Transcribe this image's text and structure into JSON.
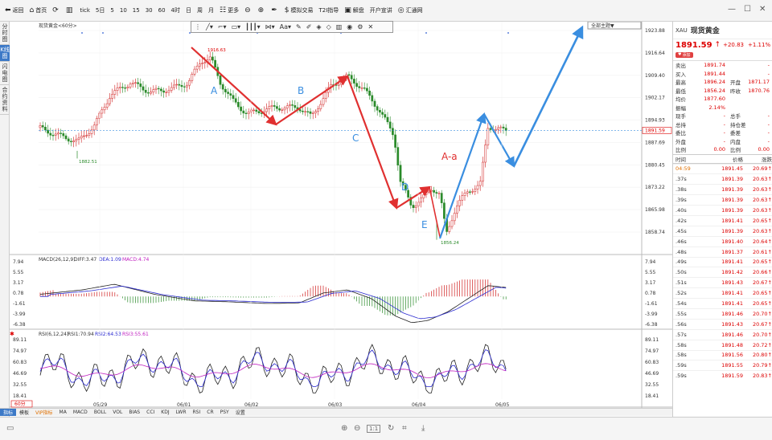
{
  "toolbar": {
    "items": [
      {
        "label": "返回",
        "icon": "arrow-left-icon"
      },
      {
        "label": "首页",
        "icon": "home-icon"
      },
      {
        "label": "",
        "icon": "refresh-icon"
      },
      {
        "label": "",
        "icon": "bar-chart-icon"
      },
      {
        "label": "tick"
      },
      {
        "label": "5日"
      },
      {
        "label": "5"
      },
      {
        "label": "10"
      },
      {
        "label": "15"
      },
      {
        "label": "30"
      },
      {
        "label": "60"
      },
      {
        "label": "4时"
      },
      {
        "label": "日"
      },
      {
        "label": "周"
      },
      {
        "label": "月"
      },
      {
        "label": "更多",
        "icon": "grid-icon"
      },
      {
        "label": "",
        "icon": "zoom-out-icon"
      },
      {
        "label": "",
        "icon": "zoom-in-icon"
      },
      {
        "label": "",
        "icon": "pen-icon"
      },
      {
        "label": "模拟交易",
        "icon": "dollar-icon"
      },
      {
        "label": "T2I指导"
      },
      {
        "label": "解盘",
        "icon": "monitor-icon"
      },
      {
        "label": "开户宣讲"
      },
      {
        "label": "汇通网",
        "icon": "globe-icon"
      }
    ]
  },
  "left_tabs": [
    "分时图",
    "K线图",
    "闪电图",
    "合约资料"
  ],
  "chart": {
    "title": "现货黄金<60分>",
    "theme_button": "全部主题▼",
    "price_labels": [
      "1923.88",
      "1916.64",
      "1909.40",
      "1902.17",
      "1894.93",
      "1887.69",
      "1880.45",
      "1873.22",
      "1865.98",
      "1858.74"
    ],
    "current_price": "1891.59",
    "high_label": "1916.63",
    "low_label1": "1882.51",
    "low_label2": "1856.24",
    "macd_legend": {
      "name": "MACD(26,12,9)",
      "diff": "DIFF:3.47",
      "dea": "DEA:1.09",
      "macd": "MACD:4.74"
    },
    "macd_labels": [
      "7.94",
      "5.55",
      "3.17",
      "0.78",
      "-1.61",
      "-3.99",
      "-6.38"
    ],
    "rsi_legend": {
      "name": "RSI(6,12,24)",
      "rsi1": "RSI1:70.94",
      "rsi2": "RSI2:64.53",
      "rsi3": "RSI3:55.61"
    },
    "rsi_labels": [
      "89.11",
      "74.97",
      "60.83",
      "46.69",
      "32.55",
      "18.41"
    ],
    "date_labels": [
      "05/29",
      "06/01",
      "06/02",
      "06/03",
      "06/04",
      "06/05"
    ],
    "annotations": [
      "A",
      "B",
      "C",
      "D",
      "E",
      "A-a"
    ],
    "period_badge": "60分"
  },
  "indicator_tabs": [
    "指标",
    "模板",
    "VIP指标",
    "MA",
    "MACD",
    "BOLL",
    "VOL",
    "BIAS",
    "CCI",
    "KDJ",
    "LWR",
    "RSI",
    "CR",
    "PSY",
    "设置"
  ],
  "quote": {
    "symbol": "XAU",
    "name": "现货黄金",
    "price": "1891.59",
    "arrow": "↑",
    "change": "+20.83",
    "change_pct": "+1.11%",
    "add_button": "添加",
    "rows": [
      {
        "k1": "卖出",
        "v1": "1891.74",
        "k2": "",
        "v2": "-"
      },
      {
        "k1": "买入",
        "v1": "1891.44",
        "k2": "",
        "v2": "-"
      },
      {
        "k1": "最高",
        "v1": "1896.24",
        "k2": "开盘",
        "v2": "1871.17"
      },
      {
        "k1": "最低",
        "v1": "1856.24",
        "k2": "昨收",
        "v2": "1870.76"
      },
      {
        "k1": "均价",
        "v1": "1877.60",
        "k2": "",
        "v2": ""
      },
      {
        "k1": "振幅",
        "v1": "2.14%",
        "k2": "",
        "v2": ""
      },
      {
        "k1": "现手",
        "v1": "-",
        "k2": "总手",
        "v2": "-"
      },
      {
        "k1": "总持",
        "v1": "-",
        "k2": "持仓差",
        "v2": "-"
      },
      {
        "k1": "委比",
        "v1": "-",
        "k2": "委差",
        "v2": "-"
      },
      {
        "k1": "外盘",
        "v1": "-",
        "k2": "内盘",
        "v2": "-"
      },
      {
        "k1": "比例",
        "v1": "0.00",
        "k2": "比例",
        "v2": "0.00"
      }
    ],
    "tick_headers": [
      "时间",
      "价格",
      "涨跌"
    ],
    "ticks": [
      {
        "t": "04:59",
        "p": "1891.45",
        "v": "20.69↑"
      },
      {
        "t": ".37s",
        "p": "1891.39",
        "v": "20.63↑"
      },
      {
        "t": ".38s",
        "p": "1891.39",
        "v": "20.63↑"
      },
      {
        "t": ".39s",
        "p": "1891.39",
        "v": "20.63↑"
      },
      {
        "t": ".40s",
        "p": "1891.39",
        "v": "20.63↑"
      },
      {
        "t": ".42s",
        "p": "1891.41",
        "v": "20.65↑"
      },
      {
        "t": ".45s",
        "p": "1891.39",
        "v": "20.63↑"
      },
      {
        "t": ".46s",
        "p": "1891.40",
        "v": "20.64↑"
      },
      {
        "t": ".48s",
        "p": "1891.37",
        "v": "20.61↑"
      },
      {
        "t": ".49s",
        "p": "1891.41",
        "v": "20.65↑"
      },
      {
        "t": ".50s",
        "p": "1891.42",
        "v": "20.66↑"
      },
      {
        "t": ".51s",
        "p": "1891.43",
        "v": "20.67↑"
      },
      {
        "t": ".52s",
        "p": "1891.41",
        "v": "20.65↑"
      },
      {
        "t": ".54s",
        "p": "1891.41",
        "v": "20.65↑"
      },
      {
        "t": ".55s",
        "p": "1891.46",
        "v": "20.70↑"
      },
      {
        "t": ".56s",
        "p": "1891.43",
        "v": "20.67↑"
      },
      {
        "t": ".57s",
        "p": "1891.46",
        "v": "20.70↑"
      },
      {
        "t": ".58s",
        "p": "1891.48",
        "v": "20.72↑"
      },
      {
        "t": ".58s",
        "p": "1891.56",
        "v": "20.80↑"
      },
      {
        "t": ".59s",
        "p": "1891.55",
        "v": "20.79↑"
      },
      {
        "t": ".59s",
        "p": "1891.59",
        "v": "20.83↑"
      }
    ]
  },
  "colors": {
    "up": "#d02020",
    "down": "#2a8a2a",
    "accent": "#3c79c7",
    "arrow_red": "#e03030",
    "arrow_blue": "#3a8ee0"
  }
}
